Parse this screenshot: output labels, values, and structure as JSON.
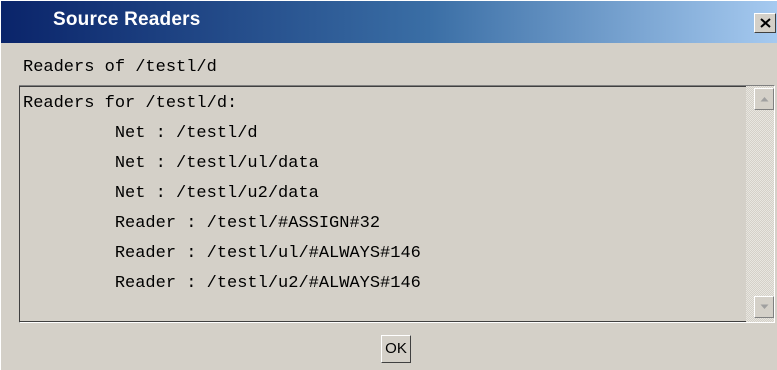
{
  "window": {
    "title": "Source Readers",
    "close_icon": "close-x-icon"
  },
  "header": {
    "label": "Readers of /testl/d"
  },
  "content": {
    "lines": [
      "Readers for /testl/d:",
      "         Net : /testl/d",
      "         Net : /testl/ul/data",
      "         Net : /testl/u2/data",
      "         Reader : /testl/#ASSIGN#32",
      "         Reader : /testl/ul/#ALWAYS#146",
      "         Reader : /testl/u2/#ALWAYS#146"
    ]
  },
  "scrollbar": {
    "up_icon": "scroll-up-arrow-icon",
    "down_icon": "scroll-down-arrow-icon"
  },
  "footer": {
    "ok_label": "OK"
  },
  "colors": {
    "title_start": "#0a246a",
    "title_end": "#a6caf0",
    "face": "#d4d0c8"
  }
}
